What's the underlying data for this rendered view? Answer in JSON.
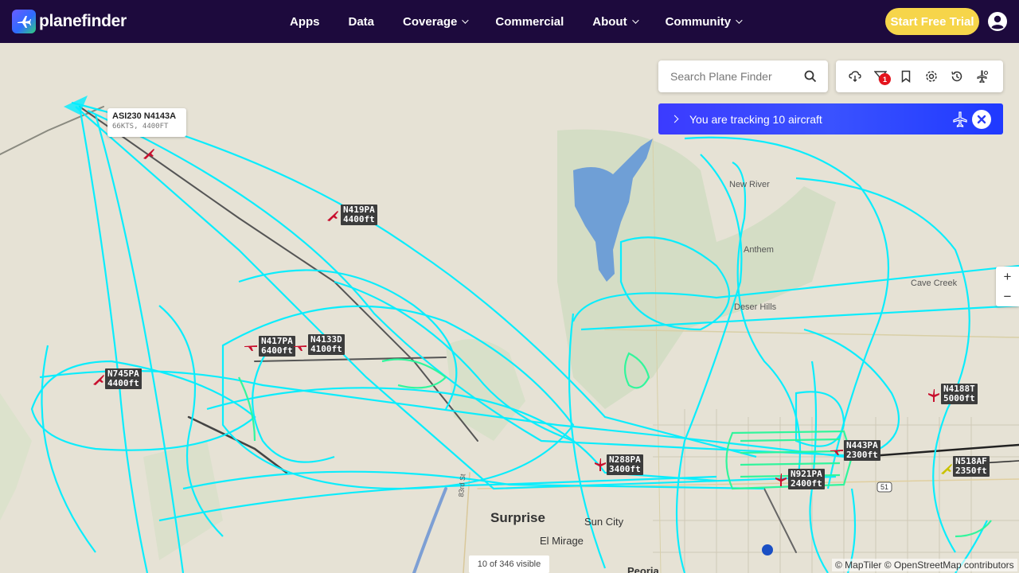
{
  "brand": {
    "name": "planefinder"
  },
  "nav": {
    "items": [
      {
        "label": "Apps",
        "dropdown": false
      },
      {
        "label": "Data",
        "dropdown": false
      },
      {
        "label": "Coverage",
        "dropdown": true
      },
      {
        "label": "Commercial",
        "dropdown": false
      },
      {
        "label": "About",
        "dropdown": true
      },
      {
        "label": "Community",
        "dropdown": true
      }
    ],
    "cta": "Start Free Trial",
    "account_icon": "user-circle-icon"
  },
  "search": {
    "placeholder": "Search Plane Finder",
    "icon": "search-icon"
  },
  "toolbar": {
    "icons": [
      "weather-icon",
      "filter-icon",
      "bookmark-icon",
      "settings-icon",
      "history-icon",
      "aircraft-settings-icon"
    ],
    "filter_badge": "1"
  },
  "tracking": {
    "text": "You are tracking 10 aircraft"
  },
  "zoom": {
    "in": "+",
    "out": "−"
  },
  "tooltip": {
    "callsign": "ASI230 N4143A",
    "details": "66KTS, 4400FT"
  },
  "aircraft": [
    {
      "id": "N419PA",
      "alt": "4400ft"
    },
    {
      "id": "N417PA",
      "alt": "6400ft"
    },
    {
      "id": "N4133D",
      "alt": "4100ft"
    },
    {
      "id": "N745PA",
      "alt": "4400ft"
    },
    {
      "id": "N288PA",
      "alt": "3400ft"
    },
    {
      "id": "N921PA",
      "alt": "2400ft"
    },
    {
      "id": "N443PA",
      "alt": "2300ft"
    },
    {
      "id": "N4188T",
      "alt": "5000ft"
    },
    {
      "id": "N518AF",
      "alt": "2350ft"
    }
  ],
  "places": {
    "new_river": "New River",
    "anthem": "Anthem",
    "desert_hills": "Deser Hills",
    "cave_creek": "Cave Creek",
    "surprise": "Surprise",
    "sun_city": "Sun City",
    "el_mirage": "El Mirage",
    "peoria": "Peoria",
    "road_51": "51",
    "road_83rd": "83rd St"
  },
  "status": {
    "visible": "10 of 346 visible"
  },
  "attribution": "© MapTiler © OpenStreetMap contributors",
  "colors": {
    "nav_bg": "#1d0a3d",
    "cta": "#f6d54a",
    "track": "#00f0ff",
    "track_low": "#2aff9a",
    "tracking_bar": "#3b3bff"
  }
}
